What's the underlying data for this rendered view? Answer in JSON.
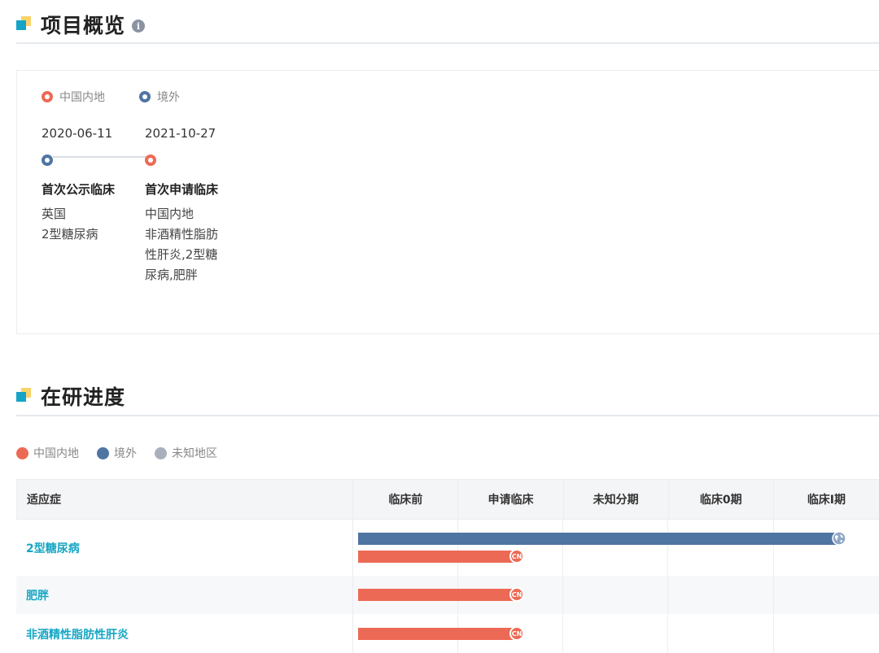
{
  "overview": {
    "title": "项目概览",
    "legend": [
      {
        "label": "中国内地",
        "color": "#ec6a55"
      },
      {
        "label": "境外",
        "color": "#4f75a3"
      }
    ],
    "events": [
      {
        "date": "2020-06-11",
        "title": "首次公示临床",
        "region": "英国",
        "indication": "2型糖尿病",
        "color": "#4f75a3"
      },
      {
        "date": "2021-10-27",
        "title": "首次申请临床",
        "region": "中国内地",
        "indication": "非酒精性脂肪性肝炎,2型糖尿病,肥胖",
        "color": "#ec6a55"
      }
    ]
  },
  "progress": {
    "title": "在研进度",
    "legend": [
      {
        "label": "中国内地",
        "color": "#ec6a55"
      },
      {
        "label": "境外",
        "color": "#4f75a3"
      },
      {
        "label": "未知地区",
        "color": "#a9b0bb"
      }
    ],
    "table": {
      "header_indication": "适应症",
      "stages": [
        "临床前",
        "申请临床",
        "未知分期",
        "临床0期",
        "临床I期"
      ],
      "rows": [
        {
          "indication": "2型糖尿病",
          "bars": [
            {
              "region": "境外",
              "stage_reached": "临床I期",
              "marker": "globe-icon"
            },
            {
              "region": "中国内地",
              "stage_reached": "申请临床",
              "marker": "CN"
            }
          ]
        },
        {
          "indication": "肥胖",
          "bars": [
            {
              "region": "中国内地",
              "stage_reached": "申请临床",
              "marker": "CN"
            }
          ]
        },
        {
          "indication": "非酒精性脂肪性肝炎",
          "bars": [
            {
              "region": "中国内地",
              "stage_reached": "申请临床",
              "marker": "CN"
            }
          ]
        }
      ]
    }
  }
}
